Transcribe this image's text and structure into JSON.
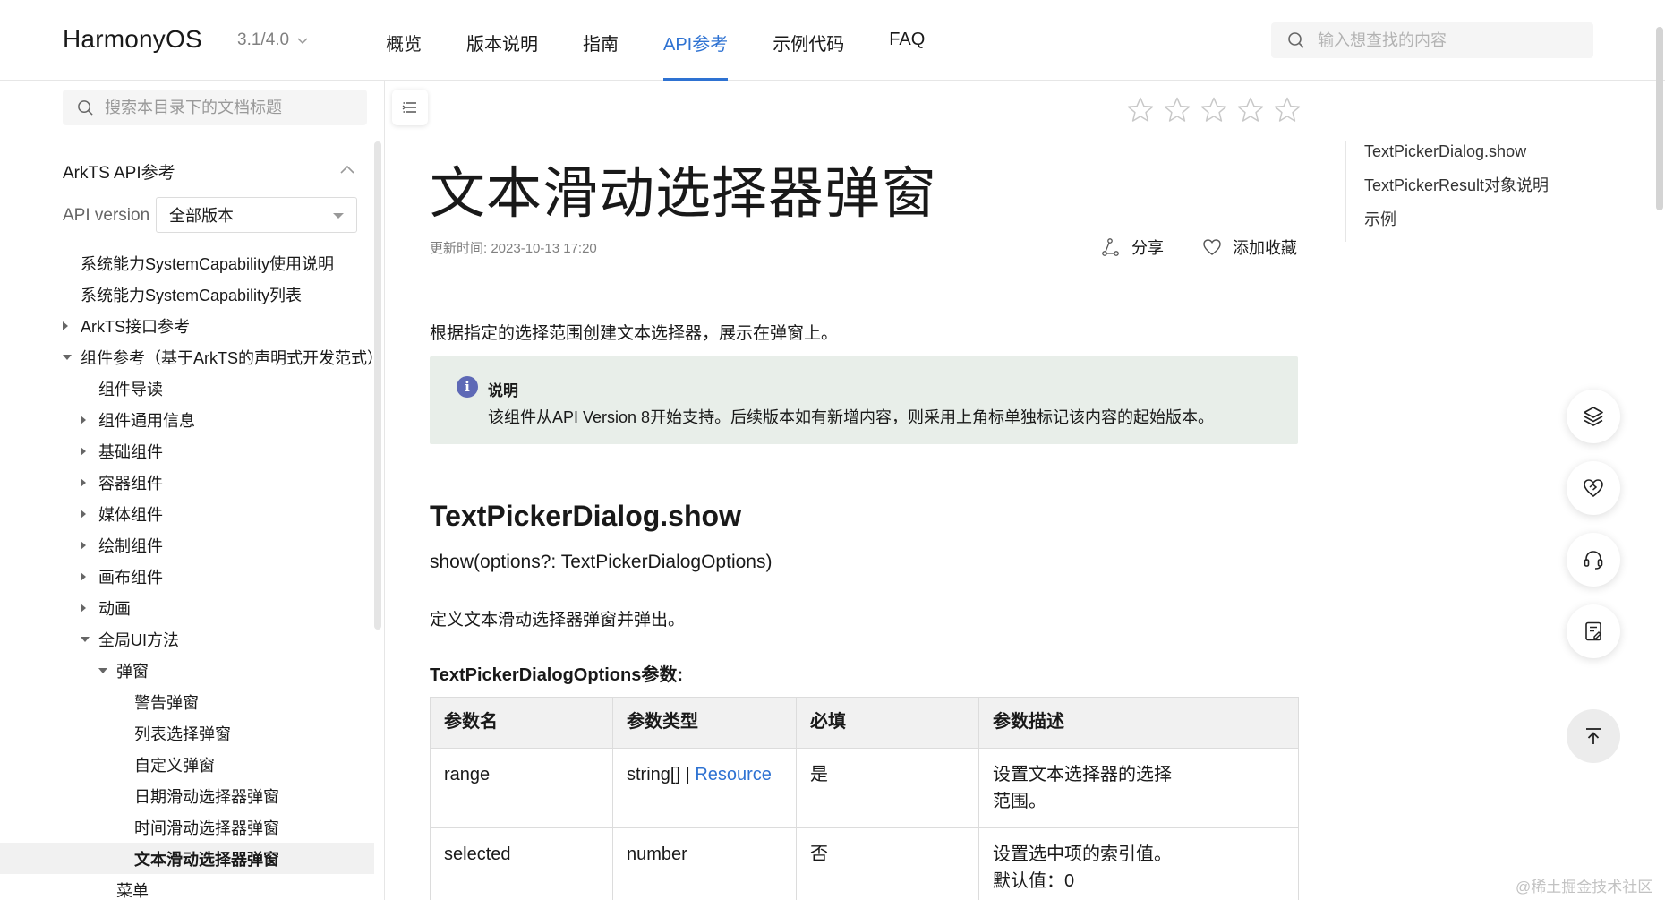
{
  "header": {
    "brand": "HarmonyOS",
    "version": "3.1/4.0",
    "nav": [
      {
        "label": "概览"
      },
      {
        "label": "版本说明"
      },
      {
        "label": "指南"
      },
      {
        "label": "API参考",
        "active": true
      },
      {
        "label": "示例代码"
      },
      {
        "label": "FAQ"
      }
    ],
    "search_placeholder": "输入想查找的内容"
  },
  "sidebar": {
    "search_placeholder": "搜索本目录下的文档标题",
    "section_title": "ArkTS API参考",
    "api_version_label": "API version",
    "api_version_value": "全部版本",
    "tree": [
      {
        "label": "系统能力SystemCapability使用说明",
        "level": 0,
        "arrow": "none"
      },
      {
        "label": "系统能力SystemCapability列表",
        "level": 0,
        "arrow": "none"
      },
      {
        "label": "ArkTS接口参考",
        "level": 0,
        "arrow": "right"
      },
      {
        "label": "组件参考（基于ArkTS的声明式开发范式）",
        "level": 0,
        "arrow": "down"
      },
      {
        "label": "组件导读",
        "level": 1,
        "arrow": "none"
      },
      {
        "label": "组件通用信息",
        "level": 1,
        "arrow": "right"
      },
      {
        "label": "基础组件",
        "level": 1,
        "arrow": "right"
      },
      {
        "label": "容器组件",
        "level": 1,
        "arrow": "right"
      },
      {
        "label": "媒体组件",
        "level": 1,
        "arrow": "right"
      },
      {
        "label": "绘制组件",
        "level": 1,
        "arrow": "right"
      },
      {
        "label": "画布组件",
        "level": 1,
        "arrow": "right"
      },
      {
        "label": "动画",
        "level": 1,
        "arrow": "right"
      },
      {
        "label": "全局UI方法",
        "level": 1,
        "arrow": "down"
      },
      {
        "label": "弹窗",
        "level": 2,
        "arrow": "down"
      },
      {
        "label": "警告弹窗",
        "level": 3,
        "arrow": "none"
      },
      {
        "label": "列表选择弹窗",
        "level": 3,
        "arrow": "none"
      },
      {
        "label": "自定义弹窗",
        "level": 3,
        "arrow": "none"
      },
      {
        "label": "日期滑动选择器弹窗",
        "level": 3,
        "arrow": "none"
      },
      {
        "label": "时间滑动选择器弹窗",
        "level": 3,
        "arrow": "none"
      },
      {
        "label": "文本滑动选择器弹窗",
        "level": 3,
        "arrow": "none",
        "selected": true
      },
      {
        "label": "菜单",
        "level": 2,
        "arrow": "none"
      }
    ]
  },
  "content": {
    "rating": {
      "stars_filled": 0,
      "stars_total": 5
    },
    "title": "文本滑动选择器弹窗",
    "updated": "更新时间: 2023-10-13 17:20",
    "share_label": "分享",
    "favorite_label": "添加收藏",
    "intro": "根据指定的选择范围创建文本选择器，展示在弹窗上。",
    "note": {
      "icon": "i",
      "heading": "说明",
      "text": "该组件从API Version 8开始支持。后续版本如有新增内容，则采用上角标单独标记该内容的起始版本。"
    },
    "section_heading": "TextPickerDialog.show",
    "signature": "show(options?: TextPickerDialogOptions)",
    "description": "定义文本滑动选择器弹窗并弹出。",
    "params_title": "TextPickerDialogOptions参数:",
    "table": {
      "headers": [
        "参数名",
        "参数类型",
        "必填",
        "参数描述"
      ],
      "rows": [
        {
          "name": "range",
          "type_text": "string[] | ",
          "type_link": "Resource",
          "required": "是",
          "desc_lines": [
            "设置文本选择器的选择",
            "范围。"
          ]
        },
        {
          "name": "selected",
          "type_text": "number",
          "type_link": "",
          "required": "否",
          "desc_lines": [
            "设置选中项的索引值。",
            "默认值：0"
          ]
        }
      ]
    }
  },
  "right_toc": [
    {
      "label": "TextPickerDialog.show"
    },
    {
      "label": "TextPickerResult对象说明"
    },
    {
      "label": "示例"
    }
  ],
  "floating_buttons": [
    {
      "icon": "layers-icon"
    },
    {
      "icon": "heart-link-icon"
    },
    {
      "icon": "headset-icon"
    },
    {
      "icon": "feedback-doc-icon"
    },
    {
      "icon": "back-to-top-icon"
    }
  ],
  "watermark": "@稀土掘金技术社区",
  "colors": {
    "accent": "#2e72d2",
    "note_bg": "#e8eee9",
    "note_icon": "#5e69b6",
    "table_header_bg": "#f1f1f1",
    "selected_bg": "#f1f1f1"
  }
}
